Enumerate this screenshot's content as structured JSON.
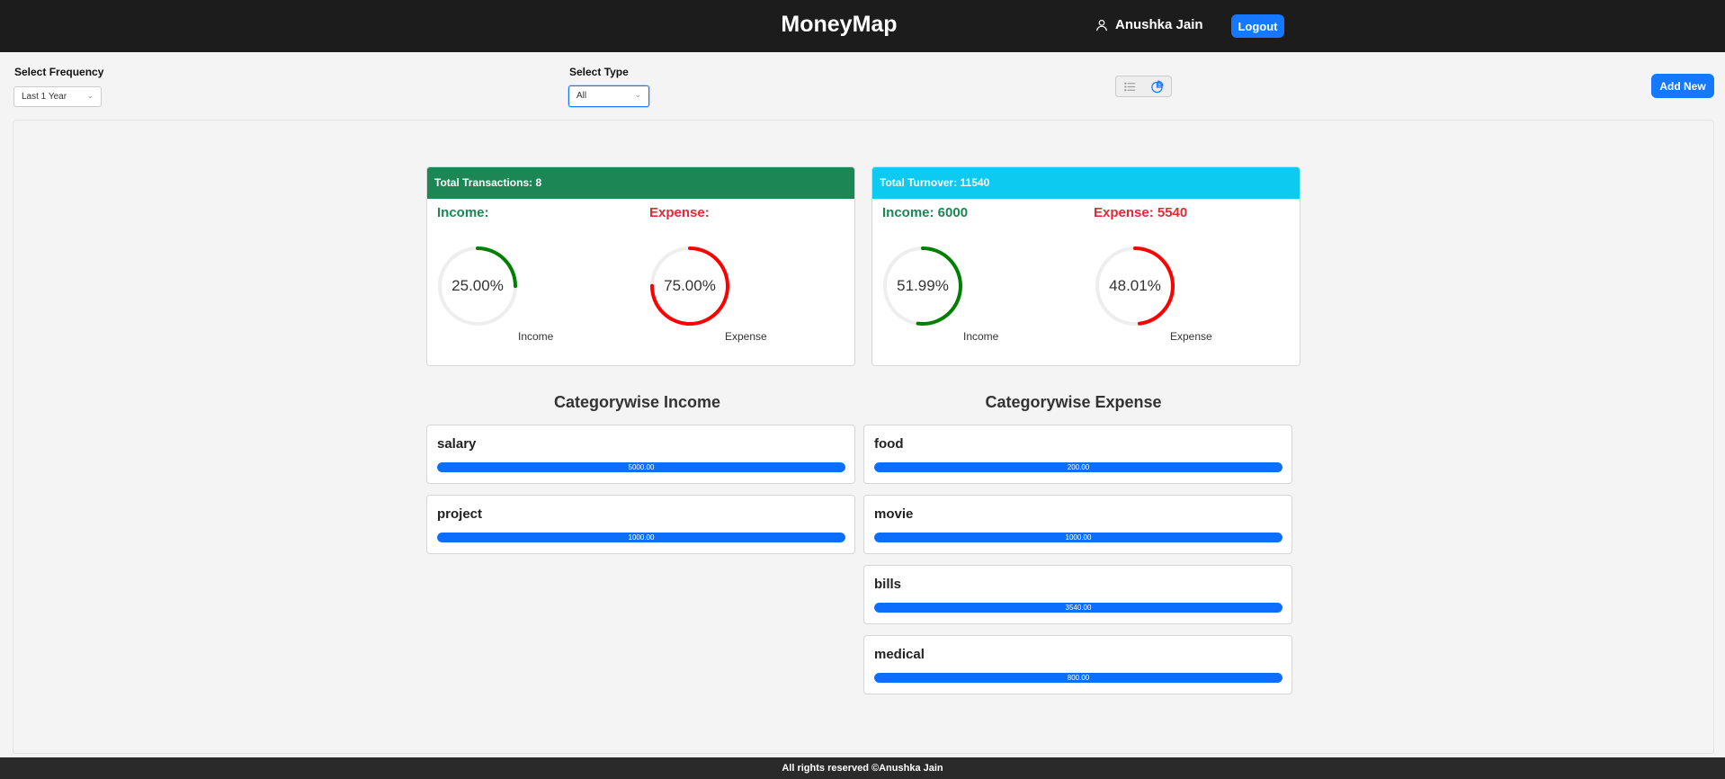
{
  "header": {
    "brand": "MoneyMap",
    "user_name": "Anushka Jain",
    "logout_label": "Logout"
  },
  "filters": {
    "frequency_label": "Select Frequency",
    "frequency_value": "Last 1 Year",
    "type_label": "Select Type",
    "type_value": "All",
    "add_new_label": "Add New",
    "view_icons": [
      "list-icon",
      "pie-chart-icon"
    ]
  },
  "transactions_card": {
    "title": "Total Transactions: 8",
    "income_heading": "Income:",
    "expense_heading": "Expense:",
    "income_percent": 25.0,
    "income_percent_label": "25.00%",
    "expense_percent": 75.0,
    "expense_percent_label": "75.00%",
    "income_caption": "Income",
    "expense_caption": "Expense",
    "header_color": "#1b8754"
  },
  "turnover_card": {
    "title": "Total Turnover: 11540",
    "income_heading": "Income: 6000",
    "expense_heading": "Expense: 5540",
    "income_percent": 51.99,
    "income_percent_label": "51.99%",
    "expense_percent": 48.01,
    "expense_percent_label": "48.01%",
    "income_caption": "Income",
    "expense_caption": "Expense",
    "header_color": "#0dcaf0"
  },
  "categorywise_income": {
    "title": "Categorywise Income",
    "items": [
      {
        "name": "salary",
        "amount": "5000.00"
      },
      {
        "name": "project",
        "amount": "1000.00"
      }
    ]
  },
  "categorywise_expense": {
    "title": "Categorywise Expense",
    "items": [
      {
        "name": "food",
        "amount": "200.00"
      },
      {
        "name": "movie",
        "amount": "1000.00"
      },
      {
        "name": "bills",
        "amount": "3540.00"
      },
      {
        "name": "medical",
        "amount": "800.00"
      }
    ]
  },
  "colors": {
    "income_ring": "#008000",
    "expense_ring": "#ff0000",
    "ring_track": "#eeeeee",
    "accent": "#1677ff",
    "progress": "#0d6efd"
  },
  "footer": {
    "text": "All rights reserved ©Anushka Jain"
  }
}
